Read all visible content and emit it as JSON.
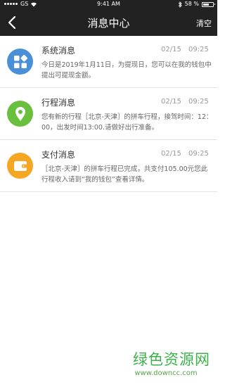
{
  "status_bar": {
    "carrier": "GS",
    "time": "9:41 AM",
    "battery": "58 %"
  },
  "header": {
    "title": "消息中心",
    "clear_label": "清空"
  },
  "messages": [
    {
      "icon": "grid-icon",
      "color": "#4a90d9",
      "title": "系统消息",
      "date": "02/15",
      "time": "09:25",
      "body": "今日是2019年1月11日，为提现日，您可以在我的钱包中提出可提现金额。"
    },
    {
      "icon": "location-pin-icon",
      "color": "#6abf3f",
      "title": "行程消息",
      "date": "02/15",
      "time": "09:25",
      "body": "您有新的行程［北京-天津］的拼车行程，接驾时间：12：00，出发时间13:00.请做好出行准备。"
    },
    {
      "icon": "wallet-icon",
      "color": "#f5a623",
      "title": "支付消息",
      "date": "02/15",
      "time": "09:25",
      "body": "［北京-天津］的拼车行程已完成，共支付105.00元您此行程收入请到“我的钱包”查看详情。"
    }
  ],
  "watermark": {
    "name": "绿色资源网",
    "url": "www.downcc.com"
  }
}
